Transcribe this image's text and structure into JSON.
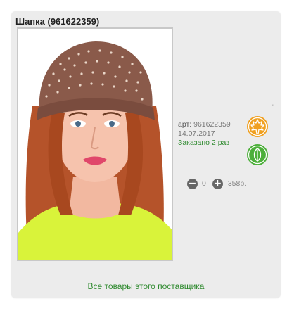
{
  "product": {
    "title": "Шапка (961622359)",
    "article_label": "арт:",
    "article_value": "961622359",
    "date": "14.07.2017",
    "ordered": "Заказано 2 раз",
    "tick_mark": "'"
  },
  "quantity": {
    "minus_glyph": "−",
    "value": "0",
    "plus_glyph": "+"
  },
  "price": "358р.",
  "supplier_link": "Все товары этого поставщика",
  "icons": {
    "badge_orange": "maple-leaf-icon",
    "badge_green": "leaf-icon",
    "minus": "minus-circle-icon",
    "plus": "plus-circle-icon"
  },
  "colors": {
    "card_bg": "#ececec",
    "link_green": "#2f8a2f",
    "badge_orange": "#f0a020",
    "badge_green": "#4caf3a"
  }
}
